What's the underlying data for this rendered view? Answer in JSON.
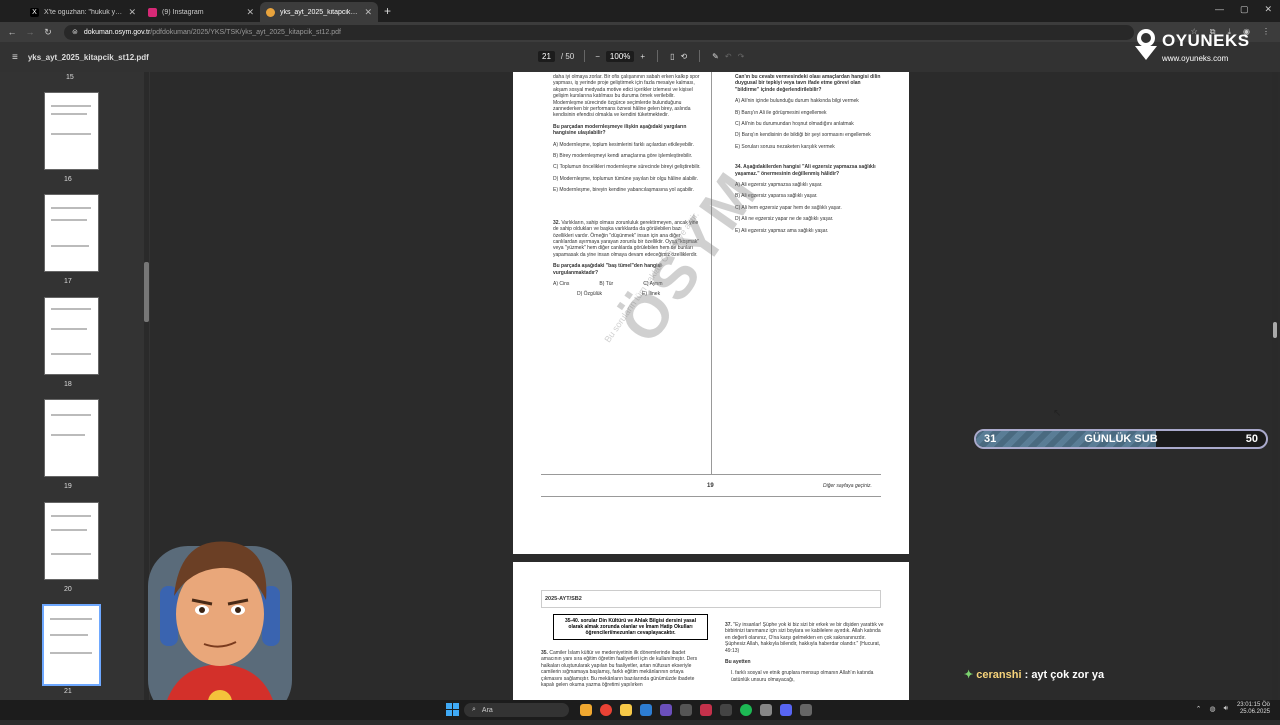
{
  "tabs": [
    {
      "label": "X'te oguzhan: \"hukuk yazan kı",
      "icon": "x-logo-icon",
      "color": "#000000"
    },
    {
      "label": "(9) Instagram",
      "icon": "instagram-icon",
      "color": "#d62976"
    },
    {
      "label": "yks_ayt_2025_kitapcik_st12.pdf",
      "icon": "pdf-icon",
      "color": "#e8a33d",
      "active": true
    }
  ],
  "url": {
    "host": "dokuman.osym.gov.tr",
    "path": "/pdfdokuman/2025/YKS/TSK/yks_ayt_2025_kitapcik_st12.pdf"
  },
  "pdf": {
    "filename": "yks_ayt_2025_kitapcik_st12.pdf",
    "page": "21",
    "total": "/ 50",
    "zoom": "100%"
  },
  "logo": {
    "brand": "OYUNEKS",
    "sub": "www.oyuneks.com"
  },
  "thumbs": [
    {
      "n": "15"
    },
    {
      "n": "16"
    },
    {
      "n": "17"
    },
    {
      "n": "18"
    },
    {
      "n": "19"
    },
    {
      "n": "20"
    },
    {
      "n": "21"
    }
  ],
  "page": {
    "left_top": "daha iyi olmaya zorlar. Bir ofis çalışanının sabah erken kalkıp spor yapması, iş yerinde proje geliştirmek için fazla mesaiye kalması, akşam sosyal medyada motive edici içerikler izlemesi ve kişisel gelişim kurslarına katılması bu duruma örnek verilebilir. Modernleşme sürecinde özgürce seçimlerde bulunduğunu zannederken bir performans öznesi hâline gelen birey, aslında kendisinin efendisi olmakla ve kendini tüketmektedir.",
    "q31": "Bu parçadan modernleşmeye ilişkin aşağıdaki yargıların hangisine ulaşılabilir?",
    "q31_opts": [
      "A) Modernleşme, toplum kesimlerini farklı açılardan etkileyebilir.",
      "B) Birey modernleşmeyi kendi amaçlarına göre işlemleştirebilir.",
      "C) Toplumun öncelikleri modernleşme sürecinde bireyi geliştirebilir.",
      "D) Modernleşme, toplumun tümüne yayılan bir olgu hâline alabilir.",
      "E) Modernleşme, bireyin kendine yabancılaşmasına yol açabilir."
    ],
    "q32_num": "32.",
    "q32": "Varlıkların, sahip olması zorunluluk gerektirmeyen, ancak yine de sahip oldukları ve başka varlıklarda da görülebilen bazı özellikleri vardır. Örneğin \"düşünmek\" insan için ana diğer canlılardan ayırmaya yarayan zorunlu bir özelliktir. Oysa \"koşmak\" veya \"yüzmek\" hem diğer canlılarda görülebilen hem de bunları yapamasak da yine insan olmaya devam edeceğimiz özelliklerdir.",
    "q32_q": "Bu parçada aşağıdaki \"baş tümel\"den hangisi vurgulanmaktadır?",
    "q32_opts": [
      "A) Cins",
      "B) Tür",
      "C) Ayrım",
      "D) Özgülük",
      "E) İlinek"
    ],
    "right_top": "Can'ın bu cevabı vermesindeki olası amaçlardan hangisi dilin duygusal bir tepkiyi veya tavrı ifade etme görevi olan \"bildirme\" içinde değerlendirilebilir?",
    "q33_opts": [
      "A) Ali'nin içinde bulunduğu durum hakkında bilgi vermek",
      "B) Barış'ın Ali ile görüşmesini engellemek",
      "C) Ali'nin bu durumundan hoşnut olmadığını anlatmak",
      "D) Barış'ın kendisinin de bildiği bir şeyi sormasını engellemek",
      "E) Soruları sorusu nezaketen karşılık vermek"
    ],
    "q34_num": "34.",
    "q34": "Aşağıdakilerden hangisi \"Ali egzersiz yapmazsa sağlıklı yaşamaz.\" önermesinin değillenmiş hâlidir?",
    "q34_opts": [
      "A) Ali egzersiz yapmazsa sağlıklı yaşar.",
      "B) Ali egzersiz yaparsa sağlıklı yaşar.",
      "C) Ali hem egzersiz yapar hem de sağlıklı yaşar.",
      "D) Ali ne egzersiz yapar ne de sağlıklı yaşar.",
      "E) Ali egzersiz yapmaz ama sağlıklı yaşar."
    ],
    "page_no": "19",
    "next": "Diğer sayfaya geçiniz.",
    "watermark": "ÖSYM",
    "watermark2": "Bu soruların tüm hakları ÖSYM'ye aittir."
  },
  "page2": {
    "code": "2025-AYT/SB2",
    "box": "35-40. sorular Din Kültürü ve Ahlak Bilgisi dersini yasal olarak almak zorunda olanlar ve İmam Hatip Okulları öğrencileri/mezunları cevaplayacaktır.",
    "q35_num": "35.",
    "q35": "Camiler İslam kültür ve medeniyetinin ilk dönemlerinde ibadet amacının yanı sıra eğitim öğretim faaliyetleri için de kullanılmıştır. Ders halkaları oluşturularak yapılan bu faaliyetler, artan nüfusun ekseriyle camilerin sığmamaya başlamış, farklı eğitim mekânlarının ortaya çıkmasını sağlamıştır. Bu mekânların bazılarında günümüzde ibadete kapalı gelen okuma yazma öğretimi yapılırken",
    "q37_num": "37.",
    "q37": "\"Ey insanlar! Şüphe yok ki biz sizi bir erkek ve bir dişiden yarattık ve birbirinizi tanımanız için sizi boylara ve kabilelere ayırdık. Allah katında en değerli olanınız, O'na karşı gelmekten en çok sakınanınızdır. Şüphesiz Allah, hakkıyla bilendir, hakkıyla haberdar olandır.\" (Hucurat, 49:13)",
    "q37_b": "Bu ayetten",
    "q37_i": "I.   farklı sosyal ve etnik gruplara mensup olmanın Allah'ın katında üstünlük unsuru olmayacağı,"
  },
  "sub": {
    "left": "31",
    "label": "GÜNLÜK SUB",
    "right": "50",
    "progress": 0.62
  },
  "chat": {
    "user": "ceranshi",
    "msg": ": ayt çok zor ya"
  },
  "taskbar": {
    "search": "Ara",
    "time": "23:01:15 Öö",
    "date": "25.06.2025"
  }
}
